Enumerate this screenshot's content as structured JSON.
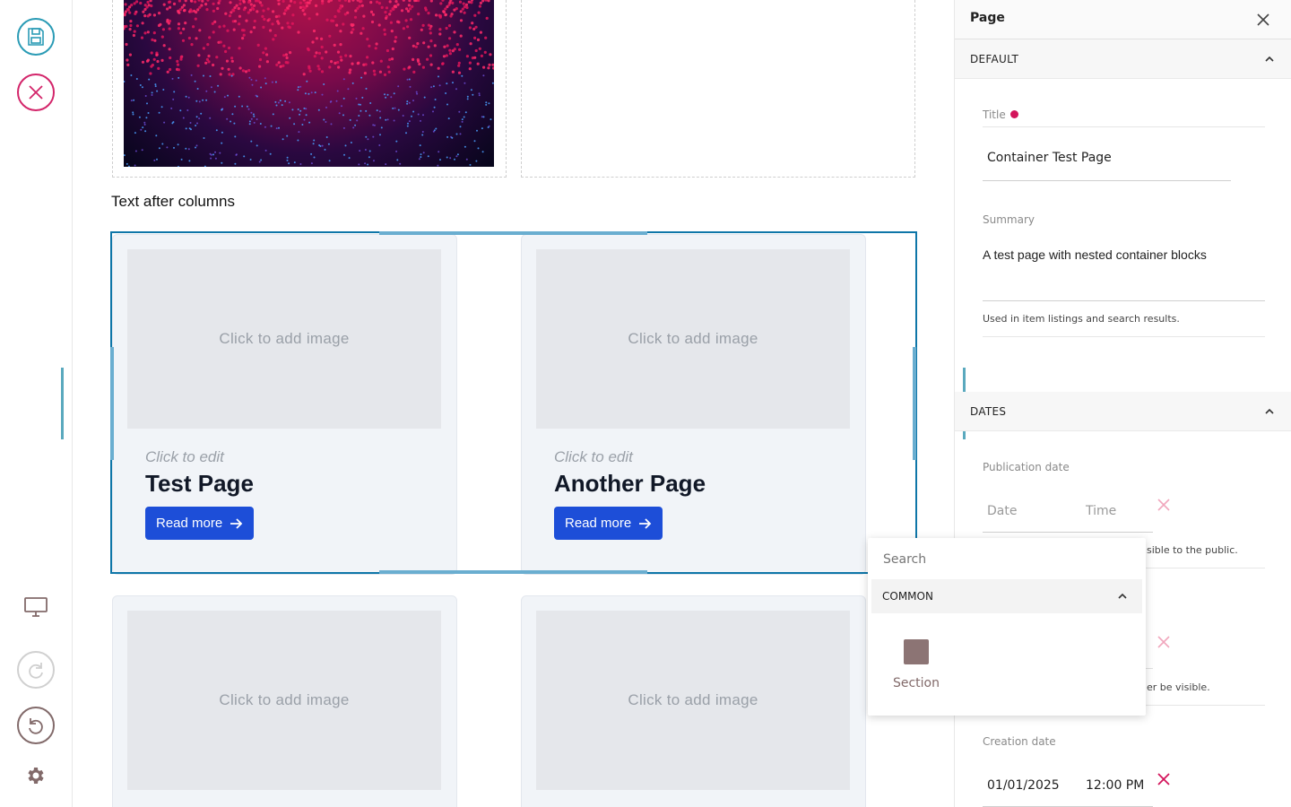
{
  "toolbar": {
    "save": "save-icon",
    "cancel": "cancel-icon",
    "view": "monitor-icon",
    "redo": "redo-icon",
    "undo": "undo-icon",
    "settings": "gear-icon"
  },
  "content": {
    "text_after_columns": "Text after columns",
    "cards": [
      {
        "image_placeholder": "Click to add image",
        "click_to_edit": "Click to edit",
        "title": "Test Page",
        "button": "Read more"
      },
      {
        "image_placeholder": "Click to add image",
        "click_to_edit": "Click to edit",
        "title": "Another Page",
        "button": "Read more"
      },
      {
        "image_placeholder": "Click to add image"
      },
      {
        "image_placeholder": "Click to add image"
      }
    ]
  },
  "sidebar": {
    "title": "Page",
    "sections": {
      "default": {
        "label": "DEFAULT",
        "title_label": "Title",
        "title_value": "Container Test Page",
        "summary_label": "Summary",
        "summary_value": "A test page with nested container blocks",
        "summary_help": "Used in item listings and search results."
      },
      "dates": {
        "label": "DATES",
        "publication_label": "Publication date",
        "publication_date_placeholder": "Date",
        "publication_time_placeholder": "Time",
        "publication_help_partial": "sible to the public.",
        "expiration_help_partial": "er be visible.",
        "creation_label": "Creation date",
        "creation_date": "01/01/2025",
        "creation_time": "12:00 PM"
      }
    }
  },
  "chooser": {
    "search_placeholder": "Search",
    "group_label": "COMMON",
    "blocks": [
      {
        "label": "Section"
      }
    ]
  },
  "colors": {
    "accent": "#2a9bb5",
    "danger": "#d3256a",
    "button": "#1d4ed8",
    "selection": "#0e76a8"
  }
}
